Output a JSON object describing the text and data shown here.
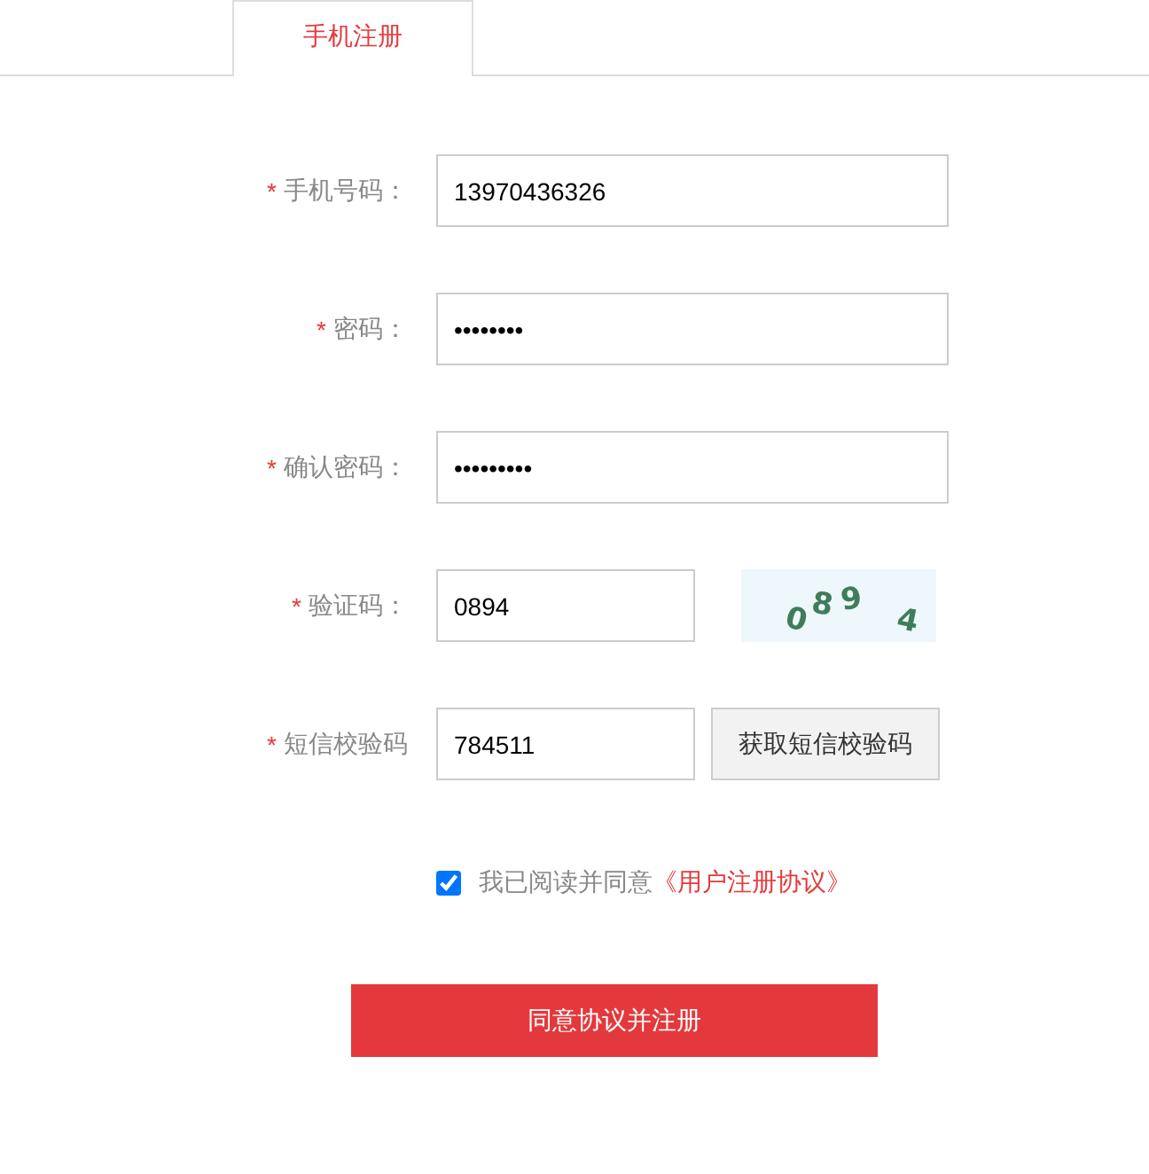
{
  "tabs": [
    {
      "label": "手机注册",
      "selected": true
    }
  ],
  "fields": [
    {
      "kind": "input",
      "mark": "*",
      "label": "手机号码：",
      "value": "13970436326"
    },
    {
      "kind": "input",
      "mark": "*",
      "label": "密码：",
      "value": "••••••••"
    },
    {
      "kind": "input",
      "mark": "*",
      "label": "确认密码：",
      "value": "•••••••••"
    },
    {
      "kind": "captcha",
      "mark": "*",
      "label": "验证码：",
      "value": "0894",
      "captcha_code": "0894"
    },
    {
      "kind": "sms",
      "mark": "*",
      "label": "短信校验码",
      "value": "784511",
      "button": "获取短信校验码"
    }
  ],
  "agreement": {
    "checked": true,
    "text": "我已阅读并同意",
    "link": "《用户注册协议》"
  },
  "submit_button": "同意协议并注册"
}
